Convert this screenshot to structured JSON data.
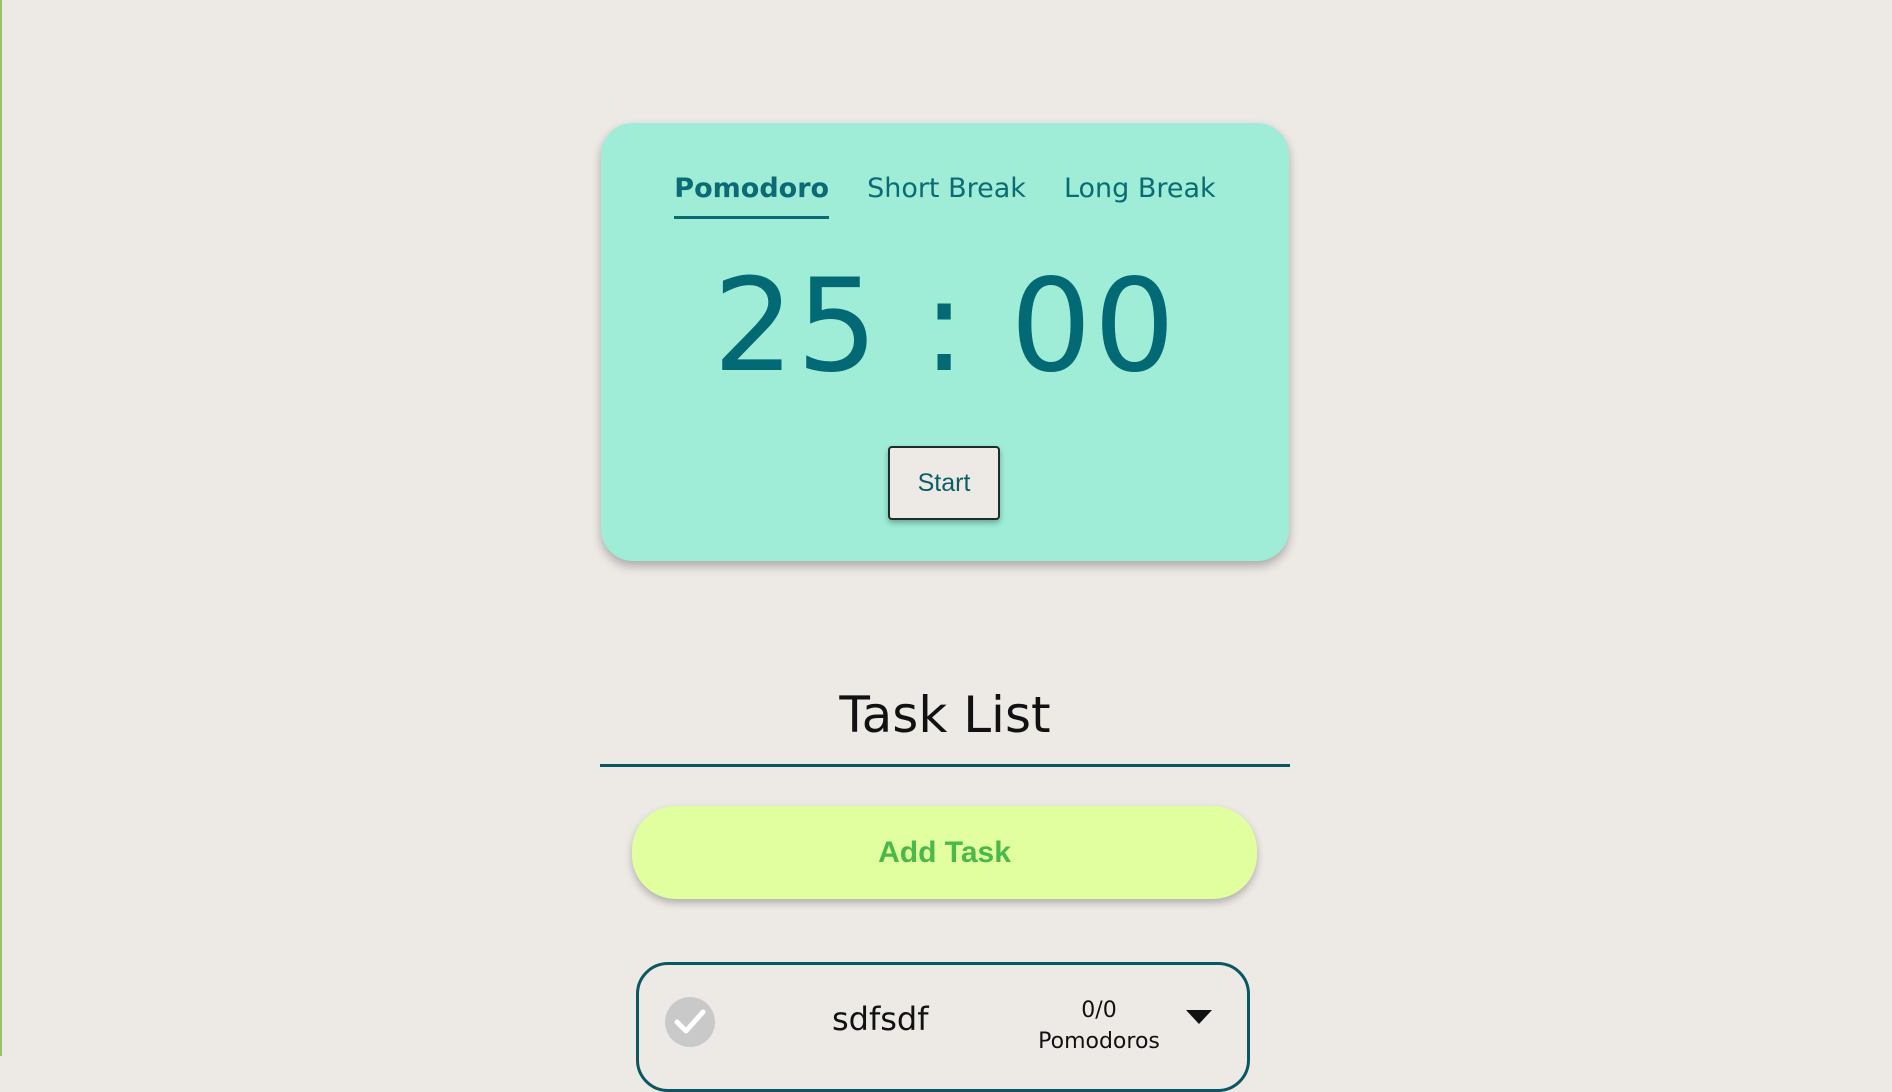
{
  "timer": {
    "tabs": [
      {
        "label": "Pomodoro",
        "active": true
      },
      {
        "label": "Short Break",
        "active": false
      },
      {
        "label": "Long Break",
        "active": false
      }
    ],
    "time": "25 : 00",
    "start_label": "Start"
  },
  "tasks": {
    "title": "Task List",
    "add_label": "Add Task",
    "items": [
      {
        "name": "sdfsdf",
        "count": "0/0",
        "unit": "Pomodoros",
        "check_icon": "check-icon",
        "menu_icon": "caret-down-icon"
      }
    ]
  },
  "colors": {
    "background": "#edeae6",
    "card": "#9fedd7",
    "accent": "#036a75",
    "add_button": "#e1ff9e",
    "add_text": "#4bb84a"
  }
}
